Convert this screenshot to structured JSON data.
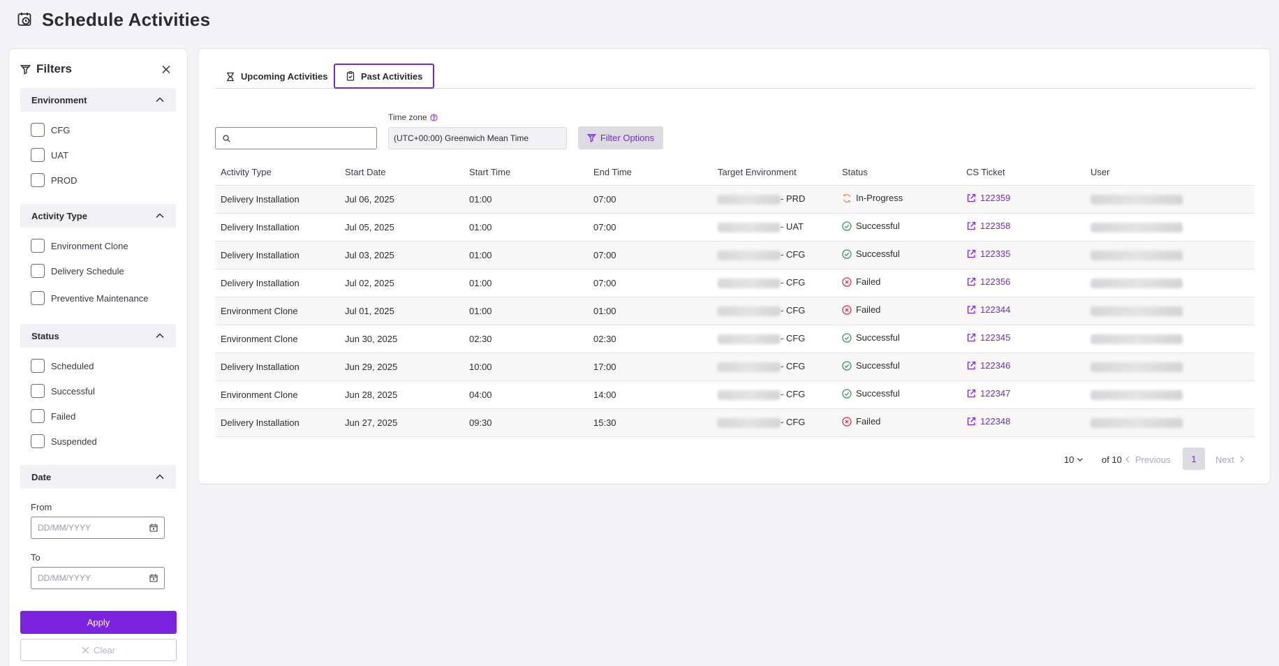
{
  "page": {
    "title": "Schedule Activities"
  },
  "sidebar": {
    "title": "Filters",
    "sections": [
      {
        "title": "Environment",
        "options": [
          "CFG",
          "UAT",
          "PROD"
        ]
      },
      {
        "title": "Activity Type",
        "options": [
          "Environment Clone",
          "Delivery Schedule",
          "Preventive Maintenance"
        ]
      },
      {
        "title": "Status",
        "options": [
          "Scheduled",
          "Successful",
          "Failed",
          "Suspended"
        ]
      },
      {
        "title": "Date"
      }
    ],
    "date": {
      "from_label": "From",
      "to_label": "To",
      "placeholder": "DD/MM/YYYY"
    },
    "apply_label": "Apply",
    "clear_label": "Clear"
  },
  "tabs": {
    "upcoming": "Upcoming Activities",
    "past": "Past Activities",
    "active": "past"
  },
  "toolbar": {
    "search_placeholder": "",
    "timezone_label": "Time zone",
    "timezone_value": "(UTC+00:00) Greenwich Mean Time",
    "filter_options_label": "Filter Options"
  },
  "table": {
    "columns": [
      "Activity Type",
      "Start Date",
      "Start Time",
      "End Time",
      "Target Environment",
      "Status",
      "CS Ticket",
      "User"
    ],
    "rows": [
      {
        "activity": "Delivery Installation",
        "start_date": "Jul 06, 2025",
        "start_time": "01:00",
        "end_time": "07:00",
        "env_suffix": "- PRD",
        "status": "In-Progress",
        "ticket": "122359"
      },
      {
        "activity": "Delivery Installation",
        "start_date": "Jul 05, 2025",
        "start_time": "01:00",
        "end_time": "07:00",
        "env_suffix": "- UAT",
        "status": "Successful",
        "ticket": "122358"
      },
      {
        "activity": "Delivery Installation",
        "start_date": "Jul 03, 2025",
        "start_time": "01:00",
        "end_time": "07:00",
        "env_suffix": "- CFG",
        "status": "Successful",
        "ticket": "122335"
      },
      {
        "activity": "Delivery Installation",
        "start_date": "Jul 02, 2025",
        "start_time": "01:00",
        "end_time": "07:00",
        "env_suffix": "- CFG",
        "status": "Failed",
        "ticket": "122356"
      },
      {
        "activity": "Environment Clone",
        "start_date": "Jul 01, 2025",
        "start_time": "01:00",
        "end_time": "01:00",
        "env_suffix": "- CFG",
        "status": "Failed",
        "ticket": "122344"
      },
      {
        "activity": "Environment Clone",
        "start_date": "Jun 30, 2025",
        "start_time": "02:30",
        "end_time": "02:30",
        "env_suffix": "- CFG",
        "status": "Successful",
        "ticket": "122345"
      },
      {
        "activity": "Delivery Installation",
        "start_date": "Jun 29, 2025",
        "start_time": "10:00",
        "end_time": "17:00",
        "env_suffix": "- CFG",
        "status": "Successful",
        "ticket": "122346"
      },
      {
        "activity": "Environment Clone",
        "start_date": "Jun 28, 2025",
        "start_time": "04:00",
        "end_time": "14:00",
        "env_suffix": "- CFG",
        "status": "Successful",
        "ticket": "122347"
      },
      {
        "activity": "Delivery Installation",
        "start_date": "Jun 27, 2025",
        "start_time": "09:30",
        "end_time": "15:30",
        "env_suffix": "- CFG",
        "status": "Failed",
        "ticket": "122348"
      }
    ]
  },
  "pagination": {
    "page_size": "10",
    "of_label": "of 10",
    "previous": "Previous",
    "current_page": "1",
    "next": "Next"
  },
  "colors": {
    "accent": "#7b24e0",
    "success": "#2e9e5b",
    "failed": "#d8334a",
    "in_progress": "#f08a4b"
  },
  "icons": {
    "page": "calendar-clock-icon",
    "filter": "filter-icon",
    "close": "close-icon",
    "collapse": "chevron-up-icon",
    "calendar": "calendar-icon",
    "upcoming_tab": "hourglass-icon",
    "past_tab": "clipboard-check-icon",
    "help": "help-circle-icon",
    "search": "search-icon",
    "external_link": "external-link-icon",
    "success": "check-circle-icon",
    "failed": "x-circle-icon",
    "in_progress": "sync-icon"
  }
}
